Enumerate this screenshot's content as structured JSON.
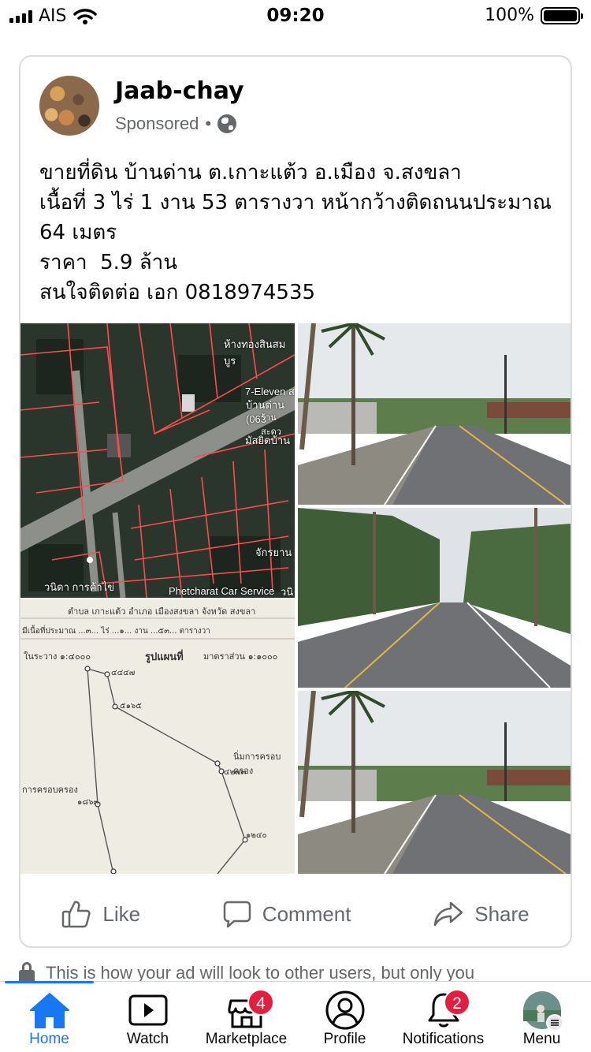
{
  "status_bar": {
    "carrier": "AIS",
    "time": "09:20",
    "battery": "100%"
  },
  "post": {
    "page_name": "Jaab-chay",
    "sponsored": "Sponsored",
    "separator": "•",
    "text_lines": [
      "ขายที่ดิน บ้านด่าน ต.เกาะแต้ว อ.เมือง จ.สงขลา",
      "เนื้อที่ 3 ไร่ 1 งาน 53 ตารางวา หน้ากว้างติดถนนประมาณ",
      "64 เมตร",
      "ราคา  5.9 ล้าน",
      "สนใจติดต่อ เอก 0818974535"
    ],
    "map_labels": {
      "store1": "ห้างทองสินสมบูร",
      "store2": "7-Eleven ส",
      "store3": "บ้านด่าน (063",
      "store4": "ร้านสะดว",
      "store5": "มัสยิดบ้าน",
      "store6": "จักรยาน",
      "store7": "วนิดา การค้าไข่",
      "store8": "Phetcharat Car Service",
      "store9": "วนิ"
    },
    "plan_labels": {
      "header1": "ตำบล เกาะแต้ว  อำเภอ เมืองสงขลา จังหวัด สงขลา",
      "header2": "มีเนื้อที่ประมาณ ...๓... ไร่ ...๑... งาน ...๕๓... ตารางวา",
      "scale_left": "ในระวาง  ๑:๔๐๐๐",
      "title": "รูปแผนที่",
      "scale_right": "มาตราส่วน  ๑:๑๐๐๐",
      "owner_right": "นิ่มการครอบครอง",
      "owner_left": "การครอบครอง",
      "p1": "๕๑๖๕",
      "p2": "๔๔๔๗",
      "p3": "๔๒๗๓",
      "p4": "๑๒๔๐",
      "p5": "๑๘๖๓"
    },
    "actions": {
      "like": "Like",
      "comment": "Comment",
      "share": "Share"
    }
  },
  "notice": "This is how your ad will look to other users, but only you",
  "tabs": [
    {
      "label": "Home",
      "active": true
    },
    {
      "label": "Watch"
    },
    {
      "label": "Marketplace",
      "badge": "4"
    },
    {
      "label": "Profile"
    },
    {
      "label": "Notifications",
      "badge": "2"
    },
    {
      "label": "Menu"
    }
  ],
  "colors": {
    "accent": "#1877f2",
    "badge": "#e41e3f",
    "secondary_text": "#65676b"
  }
}
